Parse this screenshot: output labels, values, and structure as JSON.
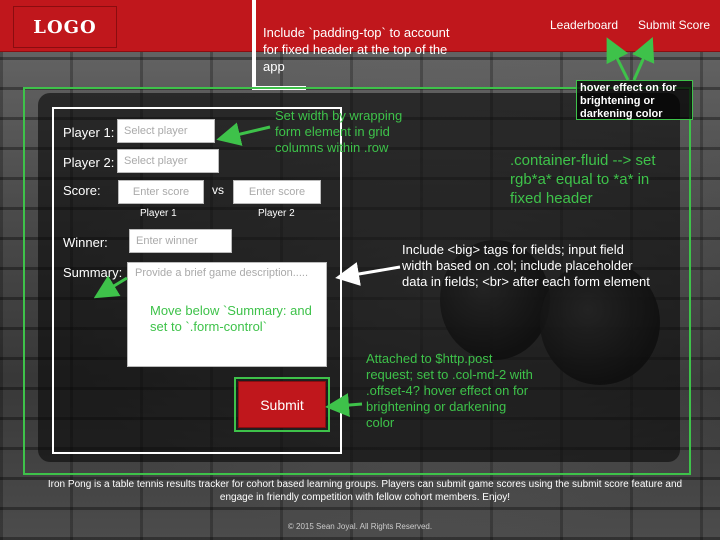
{
  "header": {
    "logo": "LOGO",
    "nav": [
      {
        "label": "Leaderboard"
      },
      {
        "label": "Submit Score"
      }
    ]
  },
  "form": {
    "player1_label": "Player 1:",
    "player1_placeholder": "Select player",
    "player2_label": "Player 2:",
    "player2_placeholder": "Select player",
    "score_label": "Score:",
    "score_placeholder_1": "Enter score",
    "vs": "vs",
    "score_placeholder_2": "Enter score",
    "score_sub_1": "Player 1",
    "score_sub_2": "Player 2",
    "winner_label": "Winner:",
    "winner_placeholder": "Enter winner",
    "summary_label": "Summary:",
    "summary_placeholder": "Provide a brief game description.....",
    "submit": "Submit"
  },
  "annotations": {
    "padding_top": "Include `padding-top` to account for fixed header at the top of the app",
    "hover_header": "hover effect on for brightening or darkening color",
    "width_note": "Set width by wrapping form element in grid columns within .row",
    "container_fluid": ".container-fluid --> set rgb*a* equal to *a* in fixed header",
    "big_tags": "Include <big> tags for fields; input field width based on .col; include placeholder data in fields; <br> after each form element",
    "move_below": "Move below `Summary: and set to `.form-control`",
    "submit_note": "Attached to $http.post request; set to .col-md-2 with .offset-4? hover effect on for brightening or darkening color"
  },
  "footer": {
    "text": "Iron Pong is a table tennis results tracker for cohort based learning groups. Players can submit game scores using the submit score feature and engage in friendly competition with fellow cohort members. Enjoy!",
    "copyright": "© 2015 Sean Joyal. All Rights Reserved."
  },
  "colors": {
    "brand_red": "#c0171c",
    "annotation_green": "#3ec24a"
  }
}
